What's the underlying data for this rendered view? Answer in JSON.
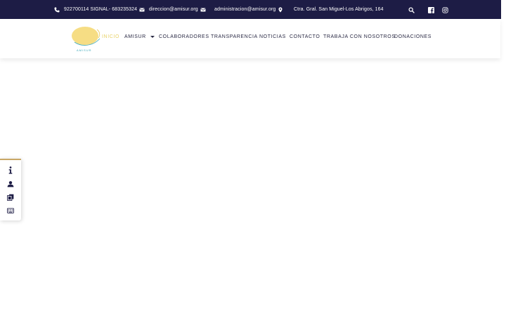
{
  "colors": {
    "topbar_bg": "#1d1c45",
    "nav_text": "#2a2a44",
    "nav_active": "#e8d36a",
    "logo_yellow": "#f6dd84",
    "logo_teal": "#3aa7b8",
    "widget_accent": "#c9a766"
  },
  "topbar": {
    "phone": "922700114 SIGNAL- 683235324",
    "email_1": "direccion@amisur.org",
    "email_2": "administracion@amisur.org",
    "address": "Ctra. Gral. San Miguel-Los Abrigos, 164",
    "icons": {
      "phone": "phone-icon",
      "email": "envelope-icon",
      "location": "map-marker-icon",
      "search": "search-icon",
      "facebook": "facebook-icon",
      "instagram": "instagram-icon"
    }
  },
  "logo": {
    "text": "AMISUR"
  },
  "nav": {
    "items": [
      {
        "label": "INICIO",
        "active": true
      },
      {
        "label": "AMISUR",
        "dropdown": true
      },
      {
        "label": "COLABORADORES"
      },
      {
        "label": "TRANSPARENCIA"
      },
      {
        "label": "NOTICIAS"
      },
      {
        "label": "CONTACTO"
      },
      {
        "label": "TRABAJA CON NOSOTROS"
      },
      {
        "label": "DONACIONES"
      }
    ]
  },
  "side_widget": {
    "icons": [
      "info-icon",
      "user-icon",
      "documents-icon",
      "keyboard-icon"
    ]
  }
}
